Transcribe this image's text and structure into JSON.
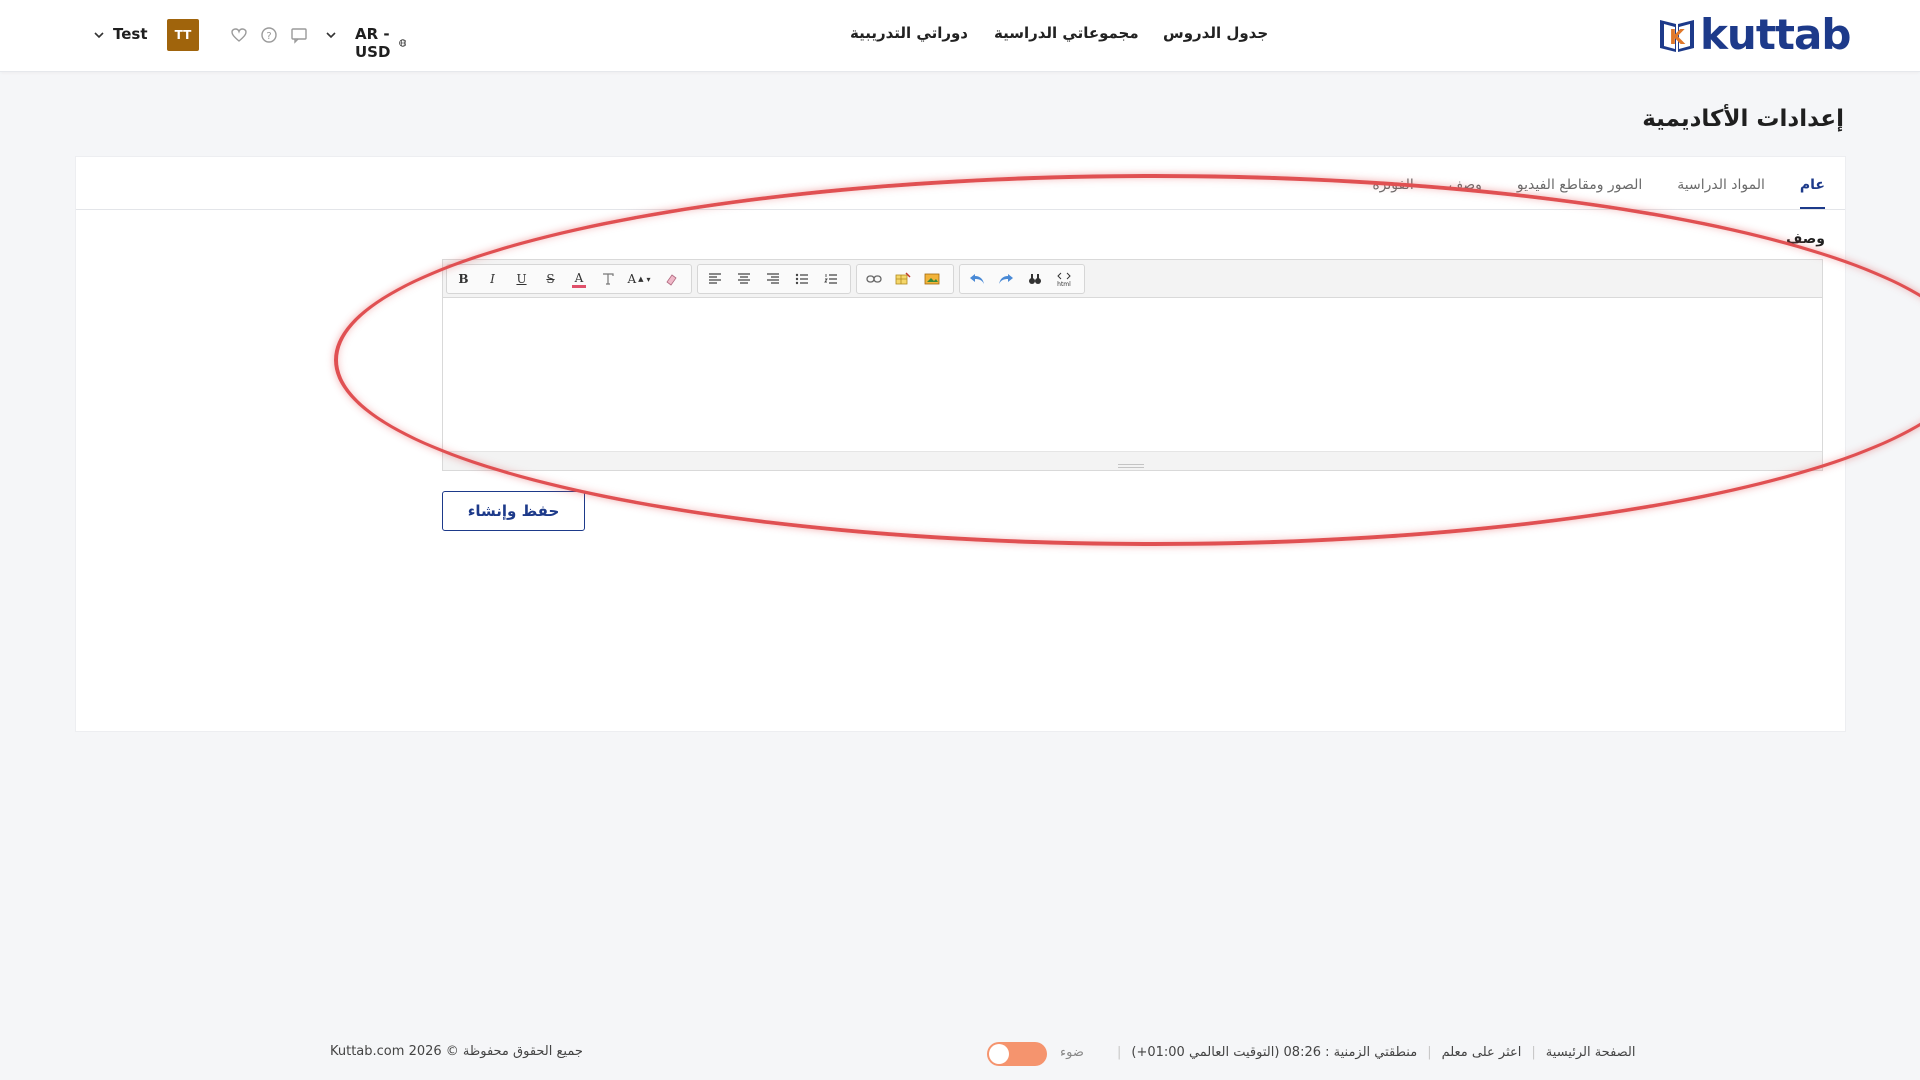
{
  "header": {
    "logo_text": "kuttab",
    "logo_letter": "K",
    "nav": [
      "جدول الدروس",
      "مجموعاتي الدراسية",
      "دوراتي التدريبية"
    ],
    "language_currency": "AR - USD",
    "avatar_initials": "TT",
    "user_name": "Test"
  },
  "page": {
    "title": "إعدادات الأكاديمية"
  },
  "tabs": [
    {
      "label": "عام",
      "active": true
    },
    {
      "label": "المواد الدراسية",
      "active": false
    },
    {
      "label": "الصور ومقاطع الفيديو",
      "active": false
    },
    {
      "label": "وصف",
      "active": false
    },
    {
      "label": "الفوترة",
      "active": false
    }
  ],
  "form": {
    "description_label": "وصف",
    "editor_value": "",
    "save_label": "حفظ وإنشاء"
  },
  "toolbar": {
    "bold": "B",
    "italic": "I",
    "underline": "U",
    "strike": "S",
    "font_color": "A",
    "font_size": "A"
  },
  "footer": {
    "links": [
      "الصفحة الرئيسية",
      "اعثر على معلم",
      "منطقتي الزمنية : 08:26 (التوقيت العالمي 01:00+)"
    ],
    "mode_label": "ضوء",
    "copyright": "جميع الحقوق محفوظة © 2026 Kuttab.com"
  },
  "colors": {
    "brand": "#1d3a8a",
    "avatar": "#a0640c",
    "toggle": "#f5946e",
    "highlight": "#e05052"
  }
}
